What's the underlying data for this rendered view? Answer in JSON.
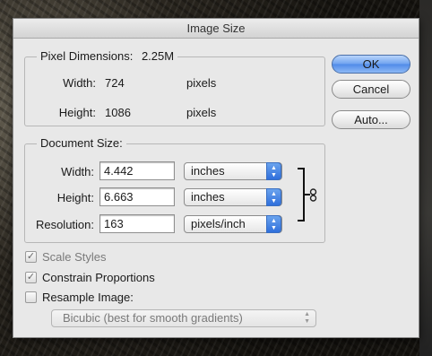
{
  "dialog": {
    "title": "Image Size"
  },
  "pixel_dimensions": {
    "legend": "Pixel Dimensions:",
    "size": "2.25M",
    "width_label": "Width:",
    "width_value": "724",
    "width_unit": "pixels",
    "height_label": "Height:",
    "height_value": "1086",
    "height_unit": "pixels"
  },
  "document_size": {
    "legend": "Document Size:",
    "width_label": "Width:",
    "width_value": "4.442",
    "width_unit": "inches",
    "height_label": "Height:",
    "height_value": "6.663",
    "height_unit": "inches",
    "resolution_label": "Resolution:",
    "resolution_value": "163",
    "resolution_unit": "pixels/inch"
  },
  "buttons": {
    "ok": "OK",
    "cancel": "Cancel",
    "auto": "Auto..."
  },
  "options": {
    "scale_styles": "Scale Styles",
    "scale_styles_checked": true,
    "constrain_proportions": "Constrain Proportions",
    "constrain_proportions_checked": true,
    "resample_image": "Resample Image:",
    "resample_image_checked": false,
    "resample_method": "Bicubic (best for smooth gradients)"
  },
  "icons": {
    "select_arrows": "updown-arrows-icon",
    "checkmark": "checkmark-icon",
    "link": "chain-link-icon"
  },
  "colors": {
    "accent": "#4f8ae8",
    "dialog_bg": "#e8e8e8"
  }
}
